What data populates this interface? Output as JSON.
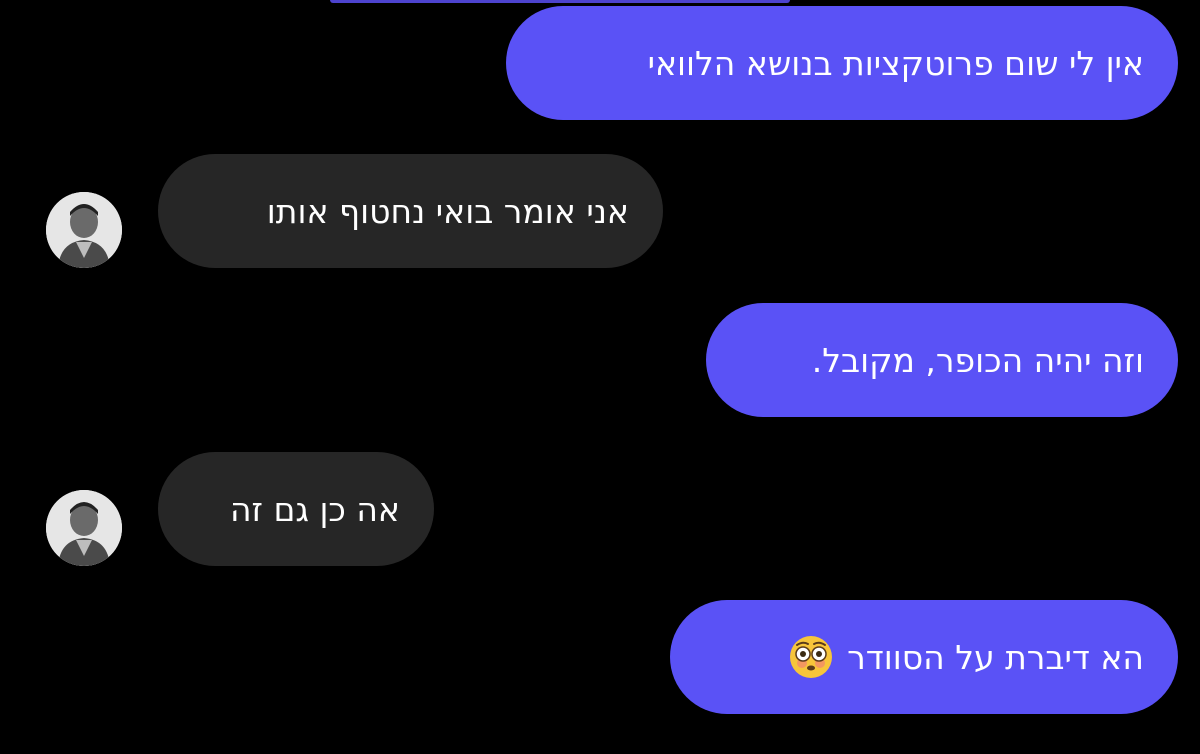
{
  "conversation": {
    "messages": [
      {
        "sender": "me",
        "text": "אין לי שום פרוטקציות בנושא הלוואי"
      },
      {
        "sender": "contact",
        "text": "אני אומר בואי נחטוף אותו"
      },
      {
        "sender": "me",
        "text": "וזה יהיה הכופר, מקובל."
      },
      {
        "sender": "contact",
        "text": "אה כן גם זה"
      },
      {
        "sender": "me",
        "text": "הא דיברת על הסוודר",
        "emoji": "flushed-face-emoji"
      }
    ]
  },
  "colors": {
    "background": "#000000",
    "sent_bubble": "#5a52f6",
    "received_bubble": "#262626",
    "text": "#ffffff"
  }
}
